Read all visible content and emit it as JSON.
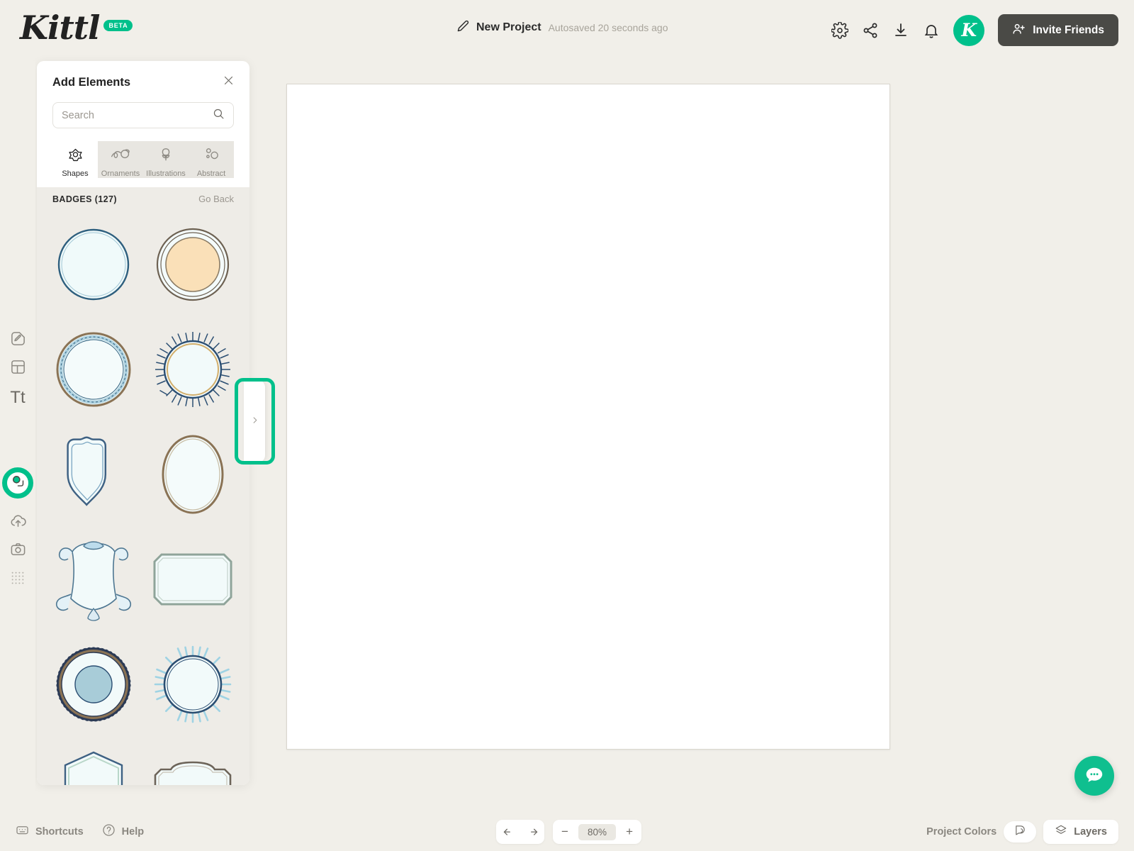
{
  "app": {
    "logo_text": "Kittl",
    "logo_badge": "BETA",
    "accent_color": "#00C08B",
    "background_color": "#F1EFE9",
    "dark_button_color": "#4A4A46"
  },
  "header": {
    "project_name": "New Project",
    "autosave_status": "Autosaved 20 seconds ago",
    "pencil_icon": "pencil-icon",
    "icons": [
      {
        "name": "settings-icon",
        "label": "Settings"
      },
      {
        "name": "share-icon",
        "label": "Share"
      },
      {
        "name": "download-icon",
        "label": "Download"
      },
      {
        "name": "notifications-icon",
        "label": "Notifications"
      }
    ],
    "avatar_initial": "K",
    "invite_label": "Invite Friends",
    "invite_icon": "add-user-icon"
  },
  "rail": {
    "items": [
      {
        "name": "design-icon",
        "label": "Design",
        "active": false
      },
      {
        "name": "templates-icon",
        "label": "Templates",
        "active": false
      },
      {
        "name": "text-icon",
        "label": "Text",
        "active": false
      },
      {
        "name": "elements-icon",
        "label": "Elements",
        "active": true
      },
      {
        "name": "upload-icon",
        "label": "Uploads",
        "active": false
      },
      {
        "name": "photos-icon",
        "label": "Photos",
        "active": false
      },
      {
        "name": "patterns-icon",
        "label": "Patterns",
        "active": false
      }
    ]
  },
  "panel": {
    "title": "Add Elements",
    "close_icon": "close-icon",
    "search": {
      "value": "",
      "placeholder": "Search",
      "icon": "search-icon"
    },
    "tabs": [
      {
        "label": "Shapes",
        "icon": "shapes-icon",
        "active": true
      },
      {
        "label": "Ornaments",
        "icon": "ornaments-icon",
        "active": false
      },
      {
        "label": "Illustrations",
        "icon": "illustrations-icon",
        "active": false
      },
      {
        "label": "Abstract",
        "icon": "abstract-icon",
        "active": false
      }
    ],
    "category_title": "BADGES (127)",
    "go_back_label": "Go Back",
    "items": [
      {
        "name": "badge-circle-blue-rim"
      },
      {
        "name": "badge-circle-orange-double-rim"
      },
      {
        "name": "badge-circle-rope"
      },
      {
        "name": "badge-circle-sunburst-navy"
      },
      {
        "name": "badge-shield-ornate"
      },
      {
        "name": "badge-oval-gold"
      },
      {
        "name": "badge-cartouche-scroll"
      },
      {
        "name": "badge-rect-rounded-corners"
      },
      {
        "name": "badge-stamp-serrated"
      },
      {
        "name": "badge-circle-sunburst-light"
      },
      {
        "name": "badge-shield-pointed"
      },
      {
        "name": "badge-plaque-ornate"
      }
    ]
  },
  "panel_handle": {
    "icon": "chevron-right-icon",
    "highlighted": true,
    "highlight_color": "#00C08B"
  },
  "footer": {
    "shortcuts_label": "Shortcuts",
    "shortcuts_icon": "keyboard-icon",
    "help_label": "Help",
    "help_icon": "question-circle-icon",
    "undo_icon": "undo-icon",
    "redo_icon": "redo-icon",
    "zoom_out_label": "−",
    "zoom_value": "80%",
    "zoom_in_label": "+",
    "project_colors_label": "Project Colors",
    "project_colors_icon": "palette-icon",
    "layers_label": "Layers",
    "layers_icon": "layers-icon",
    "chat_icon": "chat-bubble-icon"
  }
}
